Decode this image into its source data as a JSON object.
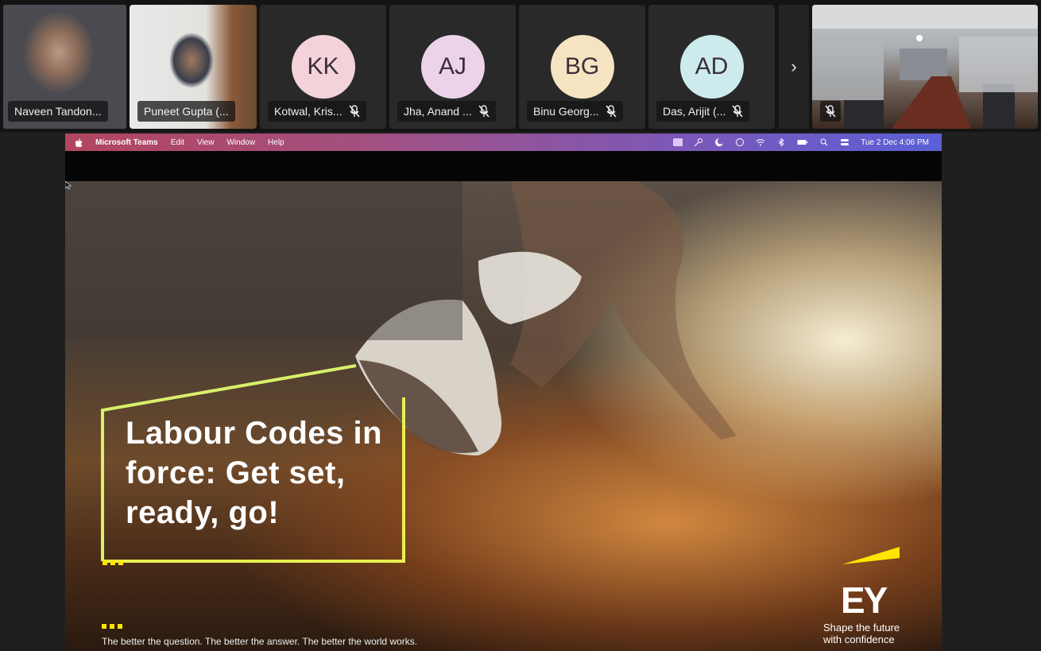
{
  "participants": [
    {
      "name": "Naveen Tandon...",
      "type": "video",
      "active": true
    },
    {
      "name": "Puneet Gupta (...",
      "type": "video"
    },
    {
      "name": "Kotwal, Kris...",
      "initials": "KK",
      "avatar_color": "#f3d3d9",
      "muted": true
    },
    {
      "name": "Jha, Anand ...",
      "initials": "AJ",
      "avatar_color": "#ecd3ea",
      "muted": true
    },
    {
      "name": "Binu Georg...",
      "initials": "BG",
      "avatar_color": "#f6e3c1",
      "muted": true
    },
    {
      "name": "Das, Arijit (...",
      "initials": "AD",
      "avatar_color": "#cdeaec",
      "muted": true
    },
    {
      "name": "",
      "type": "room-video",
      "muted": true
    }
  ],
  "more_participants_glyph": "›",
  "shared_screen": {
    "menubar": {
      "app": "Microsoft Teams",
      "items": [
        "Edit",
        "View",
        "Window",
        "Help"
      ],
      "clock": "Tue 2 Dec  4:06 PM"
    },
    "slide": {
      "title": "Labour Codes in force: Get set, ready, go!",
      "tagline": "The better the question. The better the answer. The better the world works.",
      "logo": "EY",
      "slogan_line1": "Shape the future",
      "slogan_line2": "with confidence"
    }
  },
  "colors": {
    "accent": "#7b83eb",
    "ey_yellow": "#ffe600",
    "tile_bg": "#292929"
  }
}
